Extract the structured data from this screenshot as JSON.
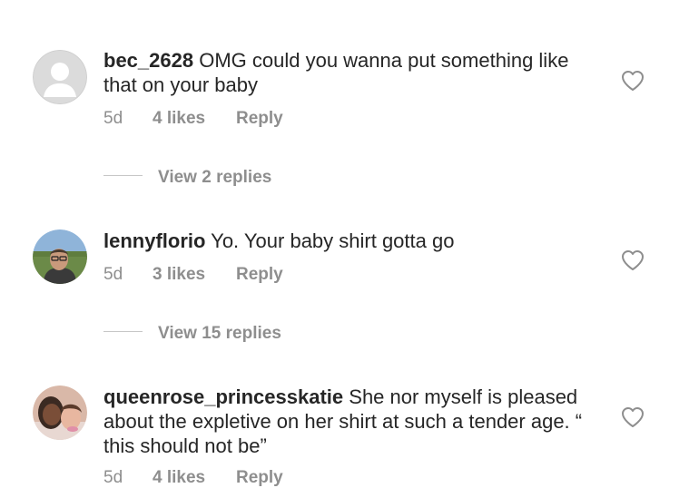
{
  "comments": [
    {
      "username": "bec_2628",
      "text": "OMG could you wanna put something like that on your baby",
      "age": "5d",
      "likes": "4 likes",
      "reply_label": "Reply",
      "avatar": "default-avatar-icon"
    },
    {
      "username": "lennyflorio",
      "text": "Yo. Your baby shirt gotta go",
      "age": "5d",
      "likes": "3 likes",
      "reply_label": "Reply",
      "avatar": "profile-photo"
    },
    {
      "username": "queenrose_princesskatie",
      "text": "She nor myself is pleased about the expletive on her shirt at such a tender age. “ this should not be”",
      "age": "5d",
      "likes": "4 likes",
      "reply_label": "Reply",
      "avatar": "profile-photo"
    }
  ],
  "view_replies": [
    "View 2 replies",
    "View 15 replies"
  ],
  "icons": {
    "like": "heart-outline-icon"
  },
  "colors": {
    "text": "#262626",
    "secondary": "#8e8e8e"
  }
}
